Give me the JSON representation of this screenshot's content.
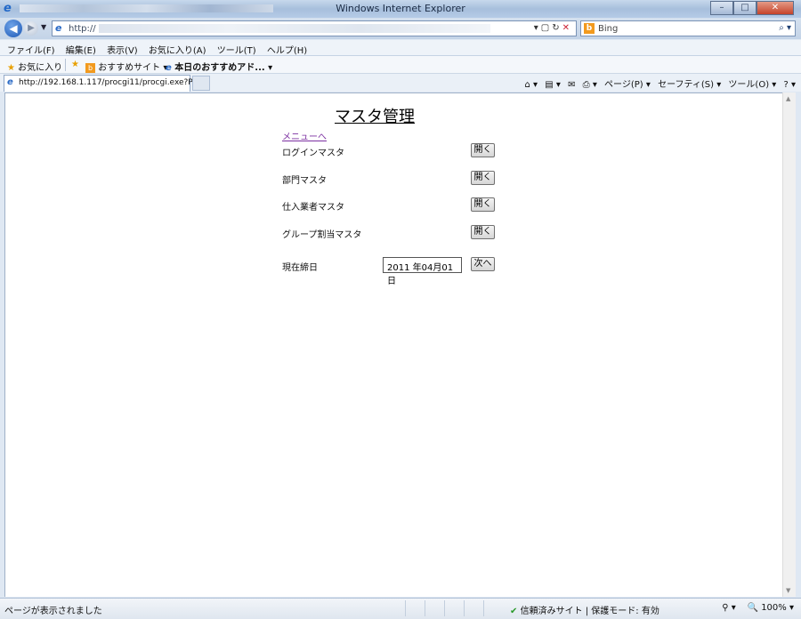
{
  "window": {
    "title": "Windows Internet Explorer",
    "buttons": {
      "minimize": "–",
      "maximize": "□",
      "close": "✕"
    }
  },
  "address_bar": {
    "url": "http://",
    "search_engine": "Bing"
  },
  "menu": [
    "ファイル(F)",
    "編集(E)",
    "表示(V)",
    "お気に入り(A)",
    "ツール(T)",
    "ヘルプ(H)"
  ],
  "favorites_bar": {
    "favorites_label": "お気に入り",
    "suggested_sites": "おすすめサイト ▾",
    "todays_pick": "本日のおすすめアド... ▾"
  },
  "tab": {
    "title": "http://192.168.1.117/procgi11/procgi.exe?P..."
  },
  "command_bar": {
    "page": "ページ(P) ▾",
    "safety": "セーフティ(S) ▾",
    "tools": "ツール(O) ▾",
    "help": "? ▾"
  },
  "page": {
    "title": "マスタ管理",
    "menu_link": "メニューへ",
    "rows": [
      {
        "label": "ログインマスタ",
        "button": "開く"
      },
      {
        "label": "部門マスタ",
        "button": "開く"
      },
      {
        "label": "仕入業者マスタ",
        "button": "開く"
      },
      {
        "label": "グループ割当マスタ",
        "button": "開く"
      }
    ],
    "closing_date": {
      "label": "現在締日",
      "value": "2011 年04月01 日",
      "next_button": "次へ"
    }
  },
  "status_bar": {
    "message": "ページが表示されました",
    "zone": "信頼済みサイト | 保護モード: 有効",
    "zoom": "100%"
  }
}
